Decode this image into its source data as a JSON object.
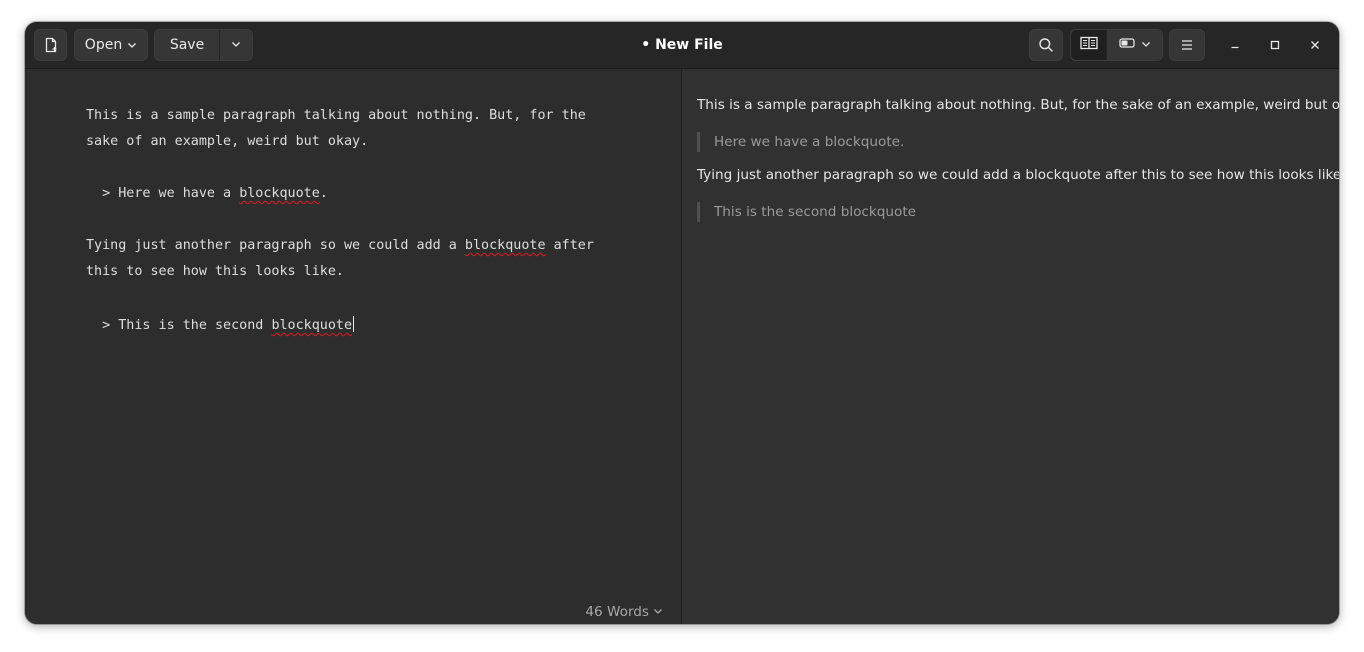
{
  "window": {
    "title": "• New File"
  },
  "toolbar": {
    "new_icon": "new-document-icon",
    "open_label": "Open",
    "save_label": "Save",
    "search_icon": "search-icon",
    "preview_mode_icon": "book-icon",
    "layout_icon": "toggle-layout-icon",
    "menu_icon": "hamburger-menu-icon"
  },
  "window_controls": {
    "minimize_icon": "minimize-icon",
    "maximize_icon": "maximize-icon",
    "close_icon": "close-icon"
  },
  "editor": {
    "line1_prefix": "This is a sample paragraph talking about nothing. But, for the",
    "line2": "sake of an example, weird but okay.",
    "bq1_prefix": "  > Here we have a ",
    "bq1_word": "blockquote",
    "bq1_suffix": ".",
    "line3_prefix": "Tying just another paragraph so we could add a ",
    "line3_word": "blockquote",
    "line3_suffix": " after",
    "line4": "this to see how this looks like.",
    "bq2_prefix": "  > This is the second ",
    "bq2_word": "blockquote"
  },
  "preview": {
    "paragraph1": "This is a sample paragraph talking about nothing. But, for the sake of an example, weird but okay.",
    "blockquote1": "Here we have a blockquote.",
    "paragraph2": "Tying just another paragraph so we could add a blockquote after this to see how this looks like.",
    "blockquote2": "This is the second blockquote"
  },
  "status": {
    "word_count": "46 Words"
  },
  "colors": {
    "window_bg": "#2d2d2d",
    "headerbar_bg": "#262626",
    "preview_bg": "#313131",
    "spell_error": "#e01b24"
  }
}
